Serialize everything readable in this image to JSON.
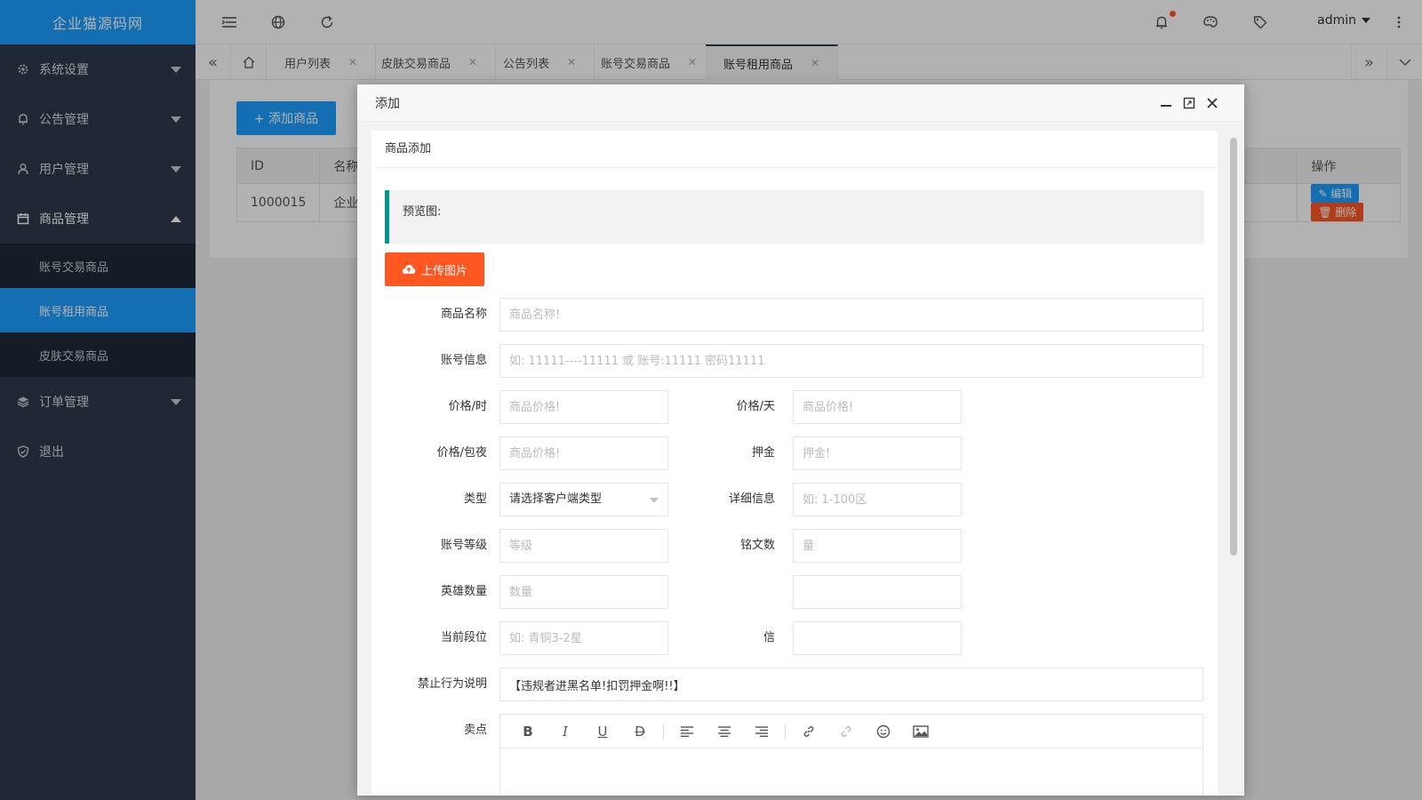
{
  "app": {
    "title": "企业猫源码网"
  },
  "sidebar": {
    "items": [
      {
        "label": "系统设置",
        "icon": "gear-icon"
      },
      {
        "label": "公告管理",
        "icon": "bell-icon"
      },
      {
        "label": "用户管理",
        "icon": "user-icon"
      },
      {
        "label": "商品管理",
        "icon": "calendar-icon"
      },
      {
        "label": "订单管理",
        "icon": "layers-icon"
      },
      {
        "label": "退出",
        "icon": "shield-check-icon"
      }
    ],
    "submenu": [
      "账号交易商品",
      "账号租用商品",
      "皮肤交易商品"
    ],
    "active_sub": "账号租用商品"
  },
  "topbar": {
    "user": "admin"
  },
  "tabs": [
    {
      "label": "用户列表"
    },
    {
      "label": "皮肤交易商品"
    },
    {
      "label": "公告列表"
    },
    {
      "label": "账号交易商品"
    },
    {
      "label": "账号租用商品",
      "active": true
    }
  ],
  "content": {
    "add_button": "+ 添加商品",
    "table": {
      "headers": [
        "ID",
        "名称",
        "操作"
      ],
      "row": {
        "id": "1000015",
        "name": "企业猫",
        "edit": "编辑",
        "delete": "删除"
      }
    }
  },
  "modal": {
    "title": "添加",
    "card_title": "商品添加",
    "preview_label": "预览图:",
    "upload_button": "上传图片",
    "fields": {
      "name": {
        "label": "商品名称",
        "placeholder": "商品名称!"
      },
      "account": {
        "label": "账号信息",
        "placeholder": "如: 11111----11111 或 账号:11111 密码11111"
      },
      "price_hour": {
        "label": "价格/时",
        "placeholder": "商品价格!"
      },
      "price_day": {
        "label": "价格/天",
        "placeholder": "商品价格!"
      },
      "price_night": {
        "label": "价格/包夜",
        "placeholder": "商品价格!"
      },
      "deposit": {
        "label": "押金",
        "placeholder": "押金!"
      },
      "type": {
        "label": "类型",
        "value": "请选择客户端类型"
      },
      "detail": {
        "label": "详细信息",
        "placeholder": "如: 1-100区"
      },
      "level": {
        "label": "账号等级",
        "placeholder": "等级"
      },
      "runes": {
        "label": "铭文数",
        "placeholder": "量"
      },
      "heroes": {
        "label": "英雄数量",
        "placeholder": "数量"
      },
      "rank": {
        "label": "当前段位",
        "placeholder": "如: 青铜3-2星"
      },
      "credit": {
        "label": "信",
        "placeholder": ""
      },
      "forbidden": {
        "label": "禁止行为说明",
        "value": "【违规者进黑名单!扣罚押金啊!!】"
      },
      "selling": {
        "label": "卖点"
      }
    }
  }
}
